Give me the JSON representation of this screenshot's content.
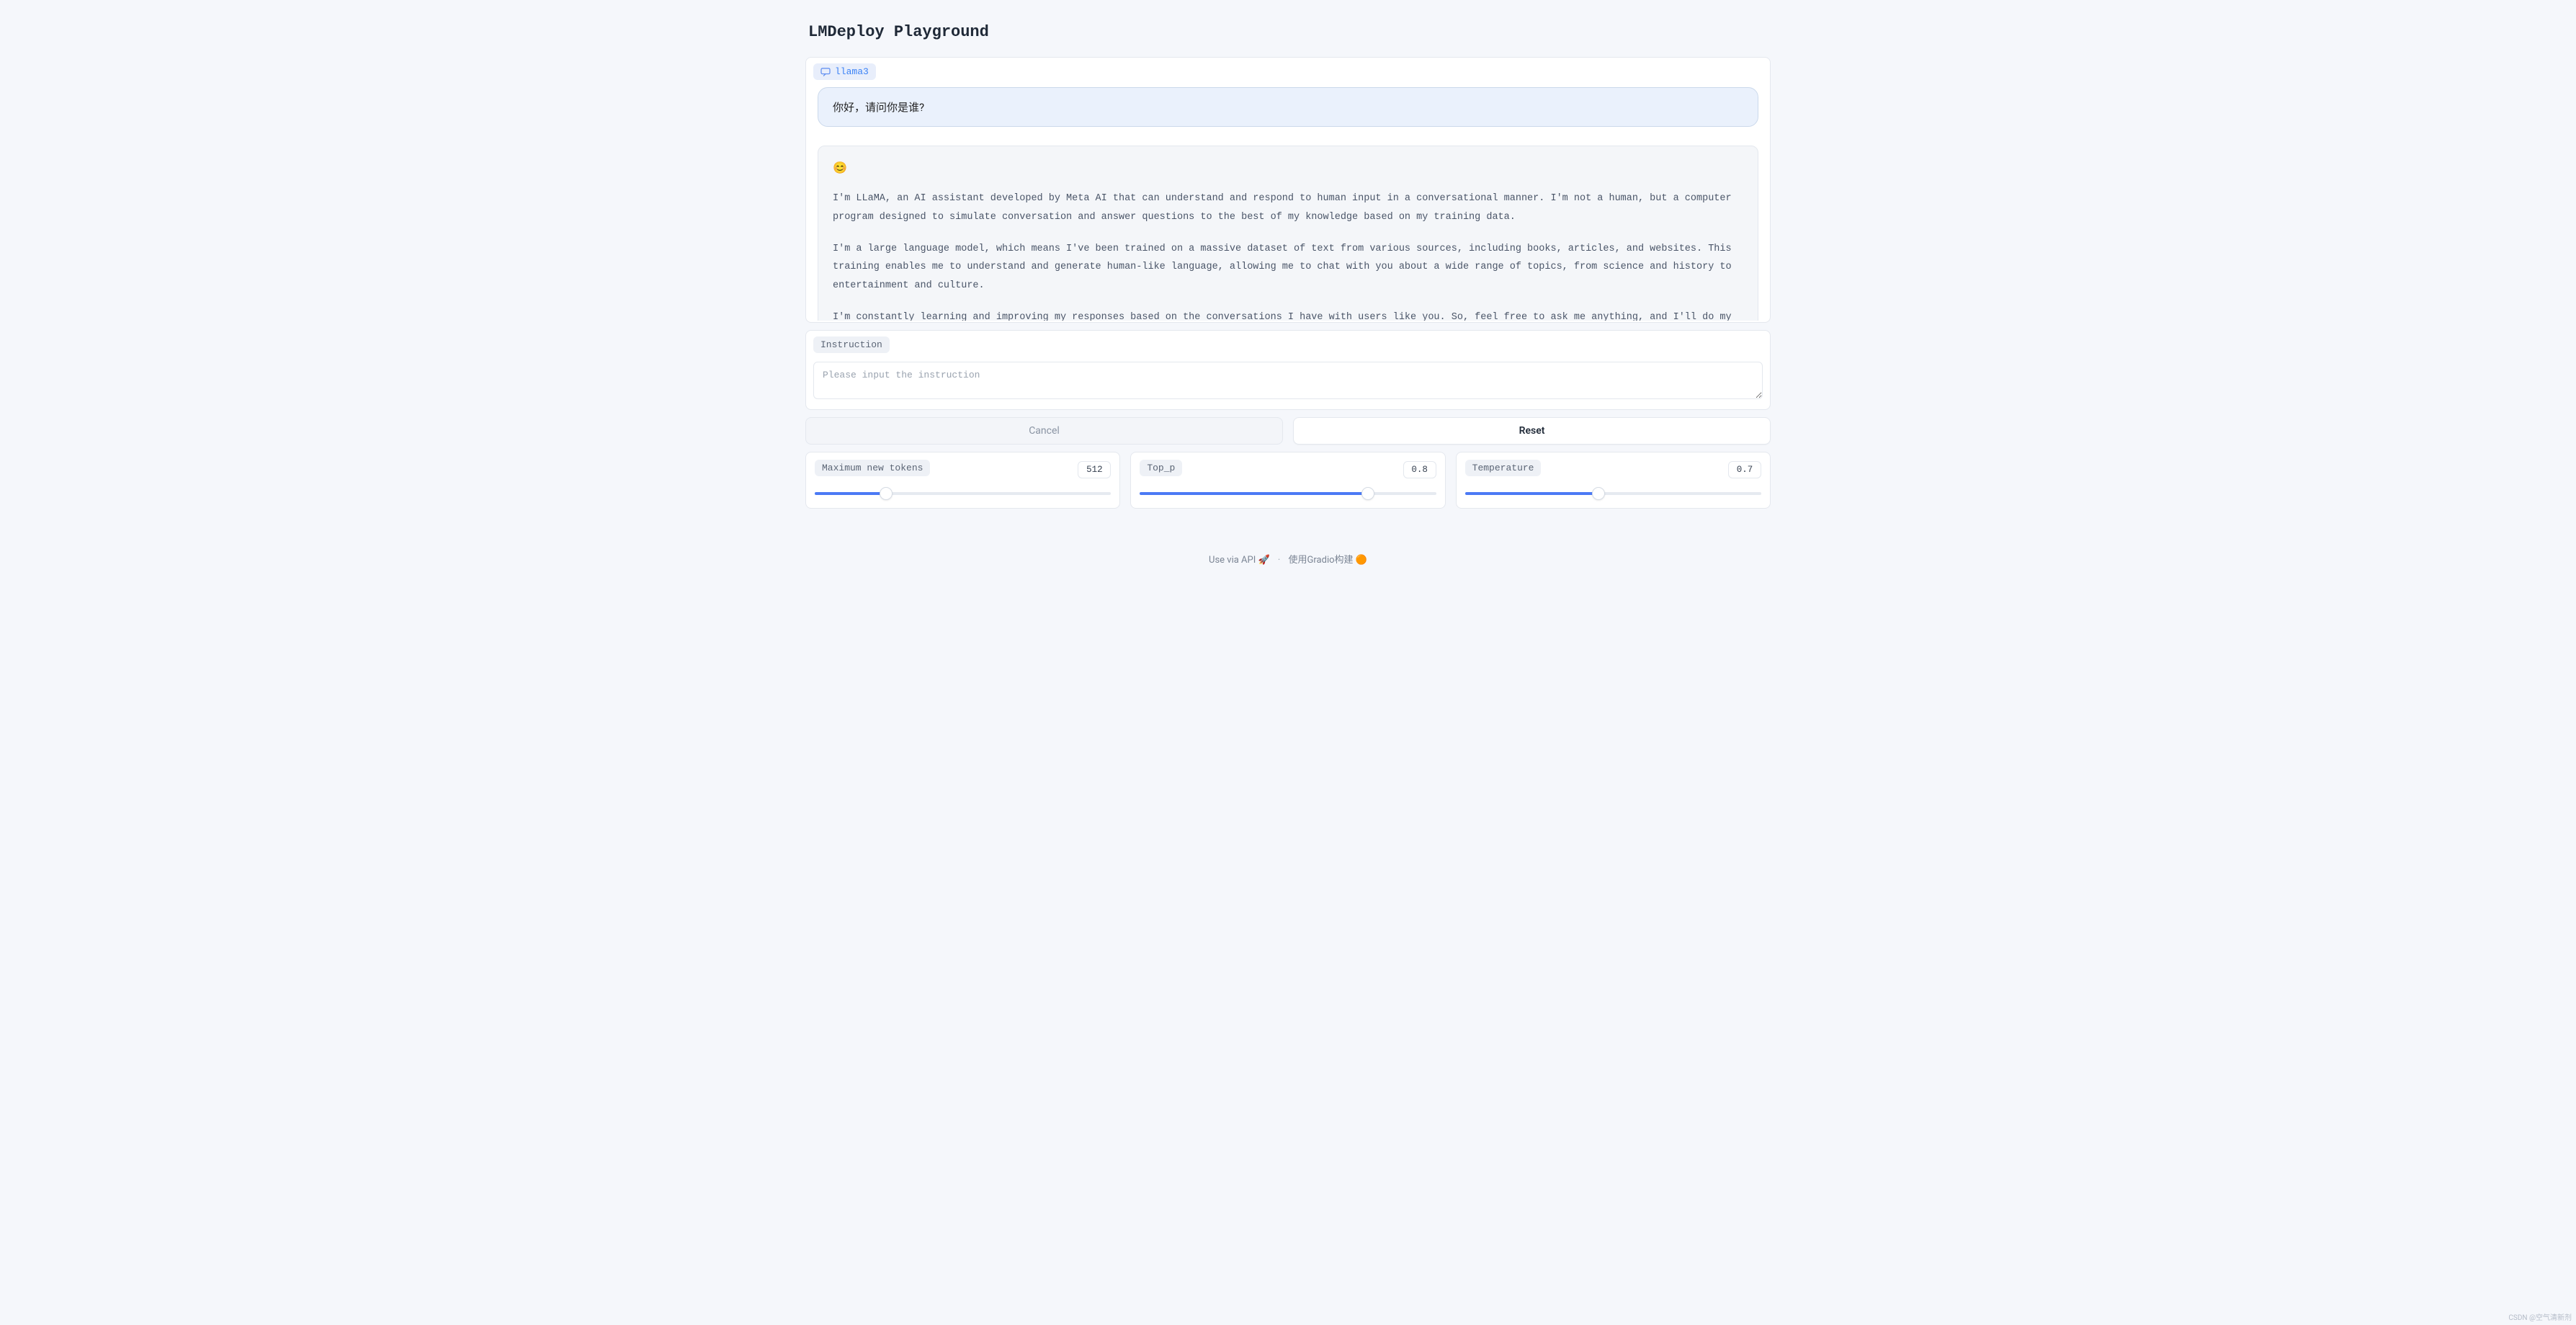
{
  "page_title": "LMDeploy Playground",
  "chat": {
    "model_label": "llama3",
    "user_message": "你好，请问你是谁?",
    "bot_emoji": "😊",
    "bot_paragraphs": [
      "I'm LLaMA, an AI assistant developed by Meta AI that can understand and respond to human input in a conversational manner. I'm not a human, but a computer program designed to simulate conversation and answer questions to the best of my knowledge based on my training data.",
      "I'm a large language model, which means I've been trained on a massive dataset of text from various sources, including books, articles, and websites. This training enables me to understand and generate human-like language, allowing me to chat with you about a wide range of topics, from science and history to entertainment and culture.",
      "I'm constantly learning and improving my responses based on the conversations I have with users like you. So, feel free to ask me anything, and I'll do my best to provide a helpful and informative response! 📟"
    ]
  },
  "instruction": {
    "label": "Instruction",
    "placeholder": "Please input the instruction",
    "value": ""
  },
  "buttons": {
    "cancel": "Cancel",
    "reset": "Reset"
  },
  "sliders": {
    "max_new_tokens": {
      "label": "Maximum new tokens",
      "value": "512",
      "fill_pct": 24
    },
    "top_p": {
      "label": "Top_p",
      "value": "0.8",
      "fill_pct": 77
    },
    "temperature": {
      "label": "Temperature",
      "value": "0.7",
      "fill_pct": 45
    }
  },
  "footer": {
    "api": "Use via API",
    "api_icon": "🚀",
    "gradio": "使用Gradio构建",
    "gradio_icon": "🟠"
  },
  "watermark": "CSDN @空气清新剂"
}
